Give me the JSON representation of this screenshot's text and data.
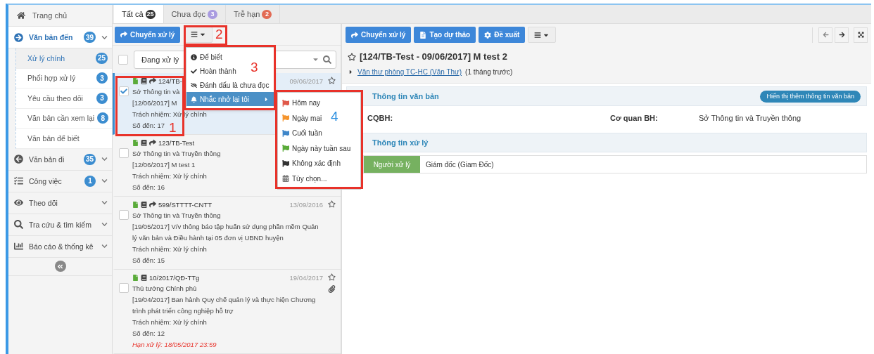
{
  "sidebar": {
    "home": "Trang chủ",
    "sections": [
      {
        "label": "Văn bản đến",
        "count": "39",
        "children": [
          {
            "label": "Xử lý chính",
            "count": "25",
            "selected": true
          },
          {
            "label": "Phối hợp xử lý",
            "count": "3",
            "selected": false
          },
          {
            "label": "Yêu cầu theo dõi",
            "count": "3",
            "selected": false
          },
          {
            "label": "Văn bản cần xem lại",
            "count": "8",
            "selected": false
          },
          {
            "label": "Văn bản để biết",
            "selected": false
          }
        ]
      },
      {
        "label": "Văn bản đi",
        "count": "35"
      },
      {
        "label": "Công việc",
        "count": "1"
      },
      {
        "label": "Theo dõi"
      },
      {
        "label": "Tra cứu & tìm kiếm"
      },
      {
        "label": "Báo cáo & thống kê"
      }
    ]
  },
  "tabs": [
    {
      "label": "Tất cả",
      "count": "25",
      "color": "#333333",
      "selected": true
    },
    {
      "label": "Chưa đọc",
      "count": "3",
      "color": "#a99be0",
      "selected": false
    },
    {
      "label": "Trễ hạn",
      "count": "2",
      "color": "#e26b55",
      "selected": false
    }
  ],
  "list_toolbar": {
    "forward_button": "Chuyển xử lý"
  },
  "filter": {
    "select_all_checked": false,
    "value": "Đang xử lý"
  },
  "documents": [
    {
      "number": "124/TB-",
      "date": "09/06/2017",
      "checked": true,
      "selected": true,
      "forwarded": true,
      "attachment": false,
      "sender": "Sở Thông tin và",
      "subject": "[12/06/2017] M",
      "responsibility": "Trách nhiệm: Xử lý chính",
      "arrival": "Số đến: 17"
    },
    {
      "number": "123/TB-Test",
      "checked": false,
      "selected": false,
      "forwarded": true,
      "attachment": false,
      "sender": "Sở Thông tin và Truyền thông",
      "subject": "[12/06/2017] M test 1",
      "responsibility": "Trách nhiệm: Xử lý chính",
      "arrival": "Số đến: 16"
    },
    {
      "number": "599/STTTT-CNTT",
      "date": "13/09/2016",
      "checked": false,
      "selected": false,
      "forwarded": true,
      "attachment": false,
      "sender": "Sở Thông tin và Truyền thông",
      "subject": "[19/05/2017] V/v thông báo tập huấn sử dụng phần mềm Quản lý văn bản và Điều hành tại 05 đơn vị UBND huyện",
      "responsibility": "Trách nhiệm: Xử lý chính",
      "arrival": "Số đến: 15"
    },
    {
      "number": "10/2017/QĐ-TTg",
      "date": "19/04/2017",
      "checked": false,
      "selected": false,
      "forwarded": false,
      "attachment": true,
      "sender": "Thủ tướng Chính phủ",
      "subject": "[19/04/2017] Ban hành Quy chế quản lý và thực hiện Chương trình phát triển công nghiệp hỗ trợ",
      "responsibility": "Trách nhiệm: Xử lý chính",
      "arrival": "Số đến: 12",
      "deadline": "Hạn xử lý: 18/05/2017 23:59"
    }
  ],
  "menu": [
    {
      "kind": "info",
      "label": "Để biết",
      "selected": false
    },
    {
      "kind": "check",
      "label": "Hoàn thành",
      "selected": false
    },
    {
      "kind": "unread",
      "label": "Đánh dấu là chưa đọc",
      "selected": false
    },
    {
      "kind": "bell",
      "label": "Nhắc nhở lại tôi",
      "selected": true
    }
  ],
  "submenu": [
    {
      "kind": "flag",
      "label": "Hôm nay",
      "color": "#e0594a"
    },
    {
      "kind": "flag",
      "label": "Ngày mai",
      "color": "#f5952e"
    },
    {
      "kind": "flag",
      "label": "Cuối tuần",
      "color": "#3f86c9"
    },
    {
      "kind": "flag",
      "label": "Ngày này tuần sau",
      "color": "#5aab3a"
    },
    {
      "kind": "flag",
      "label": "Không xác định",
      "color": "#333333"
    },
    {
      "kind": "calendar",
      "label": "Tùy chọn..."
    }
  ],
  "detail": {
    "buttons": [
      {
        "kind": "forward",
        "label": "Chuyển xử lý"
      },
      {
        "kind": "draft",
        "label": "Tạo dự thảo"
      },
      {
        "kind": "propose",
        "label": "Đề xuất"
      }
    ],
    "title": "[124/TB-Test - 09/06/2017] M test 2",
    "sender_link": "Văn thư phòng TC-HC (Văn Thư)",
    "sender_time": "(1 tháng trước)",
    "doc_section": {
      "title": "Thông tin văn bản",
      "action": "Hiển thị thêm thông tin văn bản",
      "field_label": "CQBH:",
      "agency_label": "Cơ quan BH:",
      "agency_value": "Sở Thông tin và Truyền thông"
    },
    "process_section": {
      "title": "Thông tin xử lý",
      "handler_label": "Người xử lý",
      "handler_value": "Giám đốc (Giam Đốc)"
    }
  },
  "annotations": [
    {
      "label": "1",
      "color": "#e8322a"
    },
    {
      "label": "2",
      "color": "#e8322a"
    },
    {
      "label": "3",
      "color": "#e8322a"
    },
    {
      "label": "4",
      "color": "#2b8fe0"
    }
  ]
}
